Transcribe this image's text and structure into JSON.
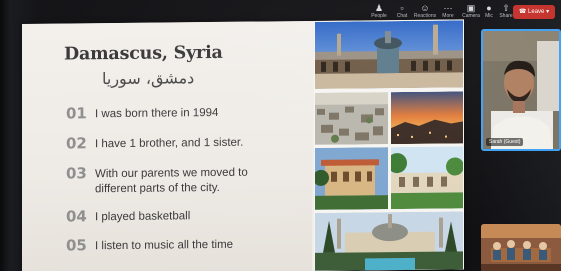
{
  "toolbar": {
    "items": [
      {
        "label": "People",
        "icon": "people-icon"
      },
      {
        "label": "Chat",
        "icon": "chat-icon"
      },
      {
        "label": "Reactions",
        "icon": "reactions-icon"
      },
      {
        "label": "More",
        "icon": "more-icon"
      },
      {
        "label": "Camera",
        "icon": "camera-icon"
      },
      {
        "label": "Mic",
        "icon": "mic-icon"
      },
      {
        "label": "Share",
        "icon": "share-icon"
      }
    ],
    "leave_label": "Leave"
  },
  "slide": {
    "title": "Damascus, Syria",
    "subtitle_arabic": "دمشق، سوريا",
    "items": [
      {
        "num": "01",
        "text": "I was born there in 1994"
      },
      {
        "num": "02",
        "text": "I have 1 brother, and 1 sister."
      },
      {
        "num": "03",
        "text": "With our parents we moved to",
        "text2": "different parts of the city."
      },
      {
        "num": "04",
        "text": "I played basketball"
      },
      {
        "num": "05",
        "text": "I listen to music all the time"
      }
    ]
  },
  "participants": [
    {
      "name": "Sarah (Guest)"
    }
  ],
  "colors": {
    "leave": "#c4302b",
    "active_speaker_border": "#3ea0f5",
    "slide_bg": "#f1ede8",
    "number": "#8f8f8f"
  }
}
